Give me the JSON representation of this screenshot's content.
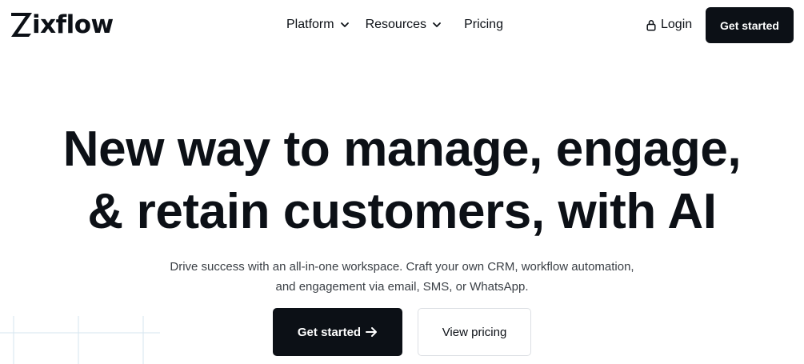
{
  "header": {
    "logo_text": "ixflow",
    "nav": [
      {
        "label": "Platform",
        "has_dropdown": true,
        "icon": "chevron-down-icon"
      },
      {
        "label": "Resources",
        "has_dropdown": true,
        "icon": "chevron-down-icon"
      },
      {
        "label": "Pricing",
        "has_dropdown": false
      }
    ],
    "login_label": "Login",
    "login_icon": "lock-icon",
    "cta_label": "Get started"
  },
  "hero": {
    "headline_lines": [
      "New way to manage, engage,",
      "& retain customers, with AI"
    ],
    "subline_lines": [
      "Drive success with an all-in-one workspace. Craft your own CRM, workflow automation,",
      "and engagement via email, SMS, or WhatsApp."
    ],
    "primary_cta_label": "Get started",
    "primary_cta_icon": "arrow-right-icon",
    "secondary_cta_label": "View pricing"
  },
  "colors": {
    "text": "#0c1016",
    "button_dark": "#0c1016",
    "button_text": "#ffffff",
    "subtext": "#3b4046",
    "border": "#dcdfe3",
    "grid_lines": "#d5e6ef"
  }
}
